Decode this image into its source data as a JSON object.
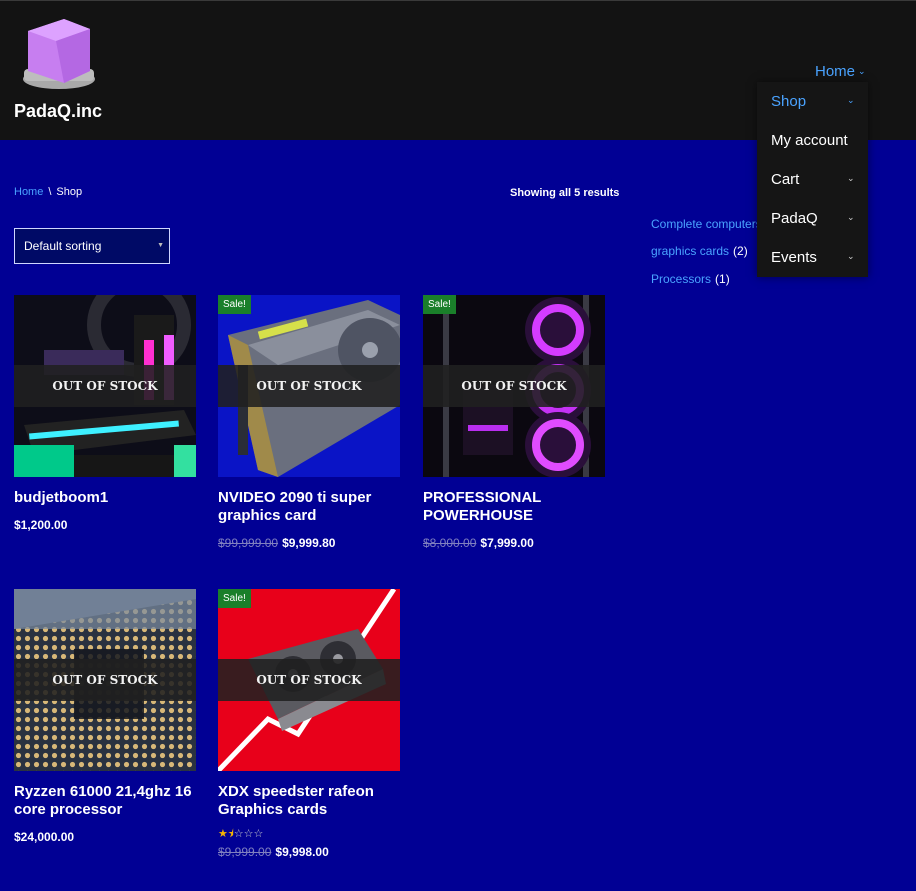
{
  "site": {
    "title": "PadaQ.inc"
  },
  "nav": {
    "home_label": "Home",
    "dropdown": [
      {
        "label": "Shop",
        "has_children": true,
        "active": true
      },
      {
        "label": "My account",
        "has_children": false
      },
      {
        "label": "Cart",
        "has_children": true
      },
      {
        "label": "PadaQ",
        "has_children": true
      },
      {
        "label": "Events",
        "has_children": true
      }
    ]
  },
  "breadcrumb": {
    "home": "Home",
    "separator": "\\",
    "current": "Shop"
  },
  "results": {
    "text": "Showing all 5 results"
  },
  "sorting": {
    "selected": "Default sorting"
  },
  "categories": [
    {
      "name": "Complete computers",
      "count": ""
    },
    {
      "name": "graphics cards",
      "count": "(2)"
    },
    {
      "name": "Processors",
      "count": "(1)"
    }
  ],
  "labels": {
    "out_of_stock": "OUT OF STOCK",
    "sale": "Sale!"
  },
  "products": [
    {
      "title": "budjetboom1",
      "price": "$1,200.00",
      "old_price": "",
      "sale": false,
      "rating_stars": 0
    },
    {
      "title": "NVIDEO 2090 ti super graphics card",
      "price": "$9,999.80",
      "old_price": "$99,999.00",
      "sale": true,
      "rating_stars": 0
    },
    {
      "title": "PROFESSIONAL POWERHOUSE",
      "price": "$7,999.00",
      "old_price": "$8,000.00",
      "sale": true,
      "rating_stars": 0
    },
    {
      "title": "Ryzzen 61000 21,4ghz 16 core processor",
      "price": "$24,000.00",
      "old_price": "",
      "sale": false,
      "rating_stars": 0
    },
    {
      "title": "XDX speedster rafeon Graphics cards",
      "price": "$9,998.00",
      "old_price": "$9,999.00",
      "sale": true,
      "rating_stars": 1.5
    }
  ],
  "colors": {
    "background": "#010094",
    "header": "#131313",
    "link": "#4aa3ff",
    "sale_badge": "#1a7f2a"
  }
}
